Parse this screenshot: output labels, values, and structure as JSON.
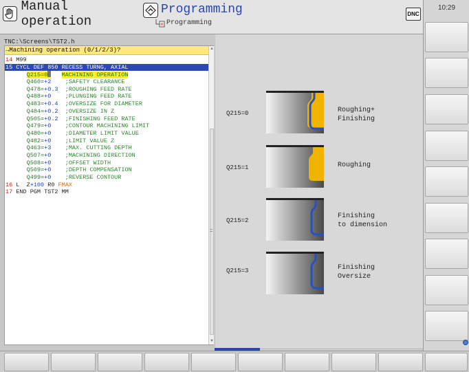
{
  "header": {
    "mode_manual": "Manual operation",
    "mode_programming": "Programming",
    "mode_programming_sub": "Programming",
    "dnc_label": "DNC"
  },
  "clock": "10:29",
  "program": {
    "path": "TNC:\\Screens\\TST2.h",
    "prompt": "→Machining operation (0/1/2/3)?",
    "lines": [
      {
        "num": "14",
        "text": " M99"
      },
      {
        "num": "15",
        "text": " CYCL DEF 850 RECESS TURNG, AXIAL"
      },
      {
        "param": "Q215=",
        "value": "0",
        "comment": "MACHINING OPERATION"
      },
      {
        "param": "Q460=",
        "value": "+2",
        "comment": ";SAFETY CLEARANCE"
      },
      {
        "param": "Q478=",
        "value": "+0.3",
        "comment": ";ROUGHING FEED RATE"
      },
      {
        "param": "Q488=",
        "value": "+0",
        "comment": ";PLUNGING FEED RATE"
      },
      {
        "param": "Q483=",
        "value": "+0.4",
        "comment": ";OVERSIZE FOR DIAMETER"
      },
      {
        "param": "Q484=",
        "value": "+0.2",
        "comment": ";OVERSIZE IN Z"
      },
      {
        "param": "Q505=",
        "value": "+0.2",
        "comment": ";FINISHING FEED RATE"
      },
      {
        "param": "Q479=",
        "value": "+0",
        "comment": ";CONTOUR MACHINING LIMIT"
      },
      {
        "param": "Q480=",
        "value": "+0",
        "comment": ";DIAMETER LIMIT VALUE"
      },
      {
        "param": "Q482=",
        "value": "+0",
        "comment": ";LIMIT VALUE Z"
      },
      {
        "param": "Q463=",
        "value": "+3",
        "comment": ";MAX. CUTTING DEPTH"
      },
      {
        "param": "Q507=",
        "value": "+0",
        "comment": ";MACHINING DIRECTION"
      },
      {
        "param": "Q508=",
        "value": "+0",
        "comment": ";OFFSET WIDTH"
      },
      {
        "param": "Q509=",
        "value": "+0",
        "comment": ";DEPTH COMPENSATION"
      },
      {
        "param": "Q499=",
        "value": "+0",
        "comment": ";REVERSE CONTOUR"
      },
      {
        "num": "16",
        "l_part": " L  Z",
        "z_value": "+100",
        "r_part": " R0 ",
        "fmax": "FMAX"
      },
      {
        "num": "17",
        "text": " END PGM TST2 MM"
      }
    ]
  },
  "help": {
    "options": [
      {
        "label": "Q215=0",
        "desc": "Roughing+\nFinishing",
        "icon": "roughing-finishing-icon"
      },
      {
        "label": "Q215=1",
        "desc": "Roughing",
        "icon": "roughing-icon"
      },
      {
        "label": "Q215=2",
        "desc": "Finishing\nto dimension",
        "icon": "finishing-icon"
      },
      {
        "label": "Q215=3",
        "desc": "Finishing\nOversize",
        "icon": "finishing-oversize-icon"
      }
    ]
  },
  "colors": {
    "highlight": "#2b48b5",
    "prompt_bg": "#ffe97a",
    "line_number": "#c02020",
    "param_green": "#2a7a2a",
    "value_blue": "#1a3fb0",
    "fmax_orange": "#e06a00",
    "stock_yellow": "#f0b400",
    "contour_blue": "#2a4fc0"
  }
}
